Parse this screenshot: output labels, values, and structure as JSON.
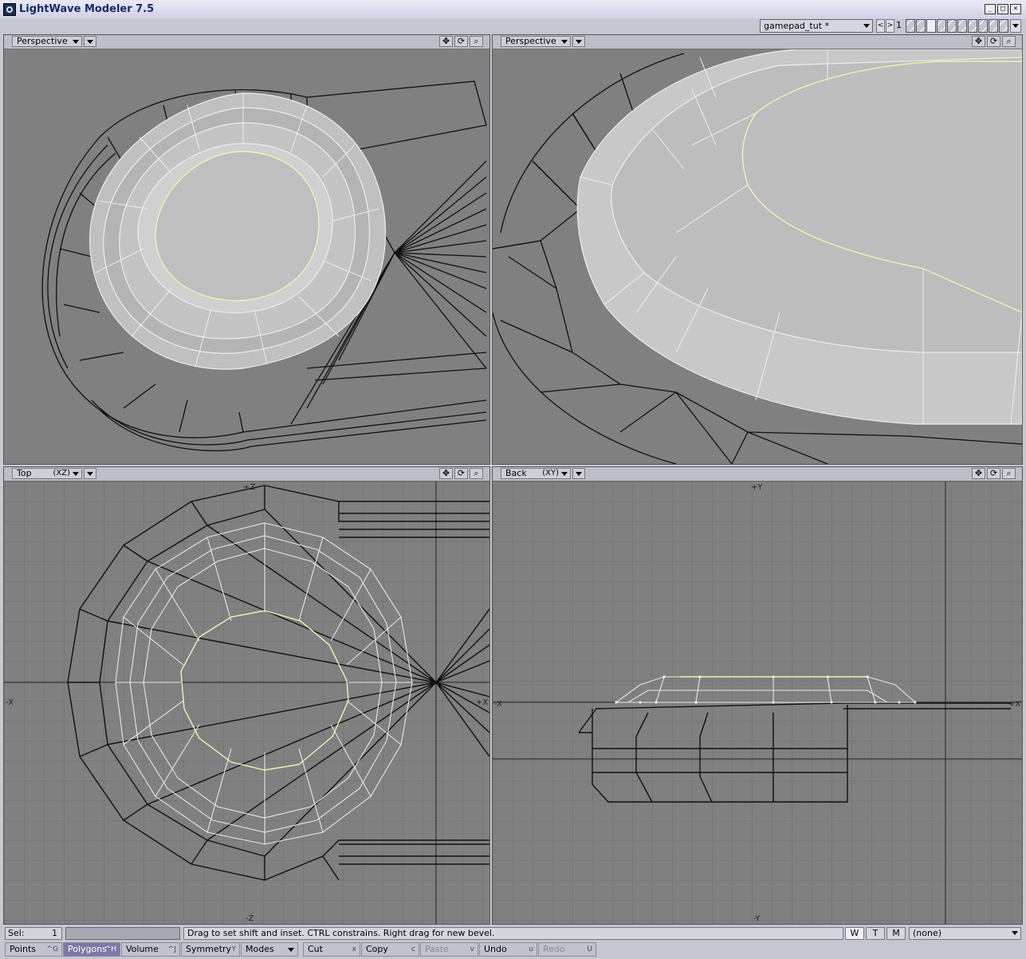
{
  "app": {
    "title": "LightWave Modeler 7.5"
  },
  "window_buttons": [
    "_",
    "□",
    "×"
  ],
  "toolbar": {
    "scene_name": "gamepad_tut *",
    "prev": "<",
    "next": ">",
    "layer_number": "1"
  },
  "viewports": [
    {
      "view": "Perspective",
      "axis": ""
    },
    {
      "view": "Perspective",
      "axis": ""
    },
    {
      "view": "Top",
      "axis": "(XZ)",
      "axis_labels": {
        "top": "+Z",
        "bottom": "-Z",
        "left": "-X",
        "right": "+X"
      }
    },
    {
      "view": "Back",
      "axis": "(XY)",
      "axis_labels": {
        "top": "+Y",
        "bottom": "-Y",
        "left": "-X",
        "right": "+X"
      }
    }
  ],
  "viewport_tool_icons": [
    "move-view-icon",
    "rotate-view-icon",
    "zoom-view-icon"
  ],
  "status": {
    "sel_label": "Sel:",
    "sel_value": "1",
    "hint": "Drag to set shift and inset. CTRL constrains. Right drag for new bevel.",
    "wtm": [
      "W",
      "T",
      "M"
    ],
    "surface": "(none)"
  },
  "modes": [
    {
      "label": "Points",
      "key": "^G"
    },
    {
      "label": "Polygons",
      "key": "^H"
    },
    {
      "label": "Volume",
      "key": "^J"
    },
    {
      "label": "Symmetry",
      "key": "Y"
    },
    {
      "label": "Modes",
      "key": ""
    },
    {
      "label": "Cut",
      "key": "x"
    },
    {
      "label": "Copy",
      "key": "c"
    },
    {
      "label": "Paste",
      "key": "v"
    },
    {
      "label": "Undo",
      "key": "u"
    },
    {
      "label": "Redo",
      "key": "U"
    }
  ],
  "colors": {
    "viewport_bg": "#808080",
    "selected_edge": "#f2f2b0",
    "wire": "#101010",
    "highlight_mode": "#7a7aa6"
  }
}
